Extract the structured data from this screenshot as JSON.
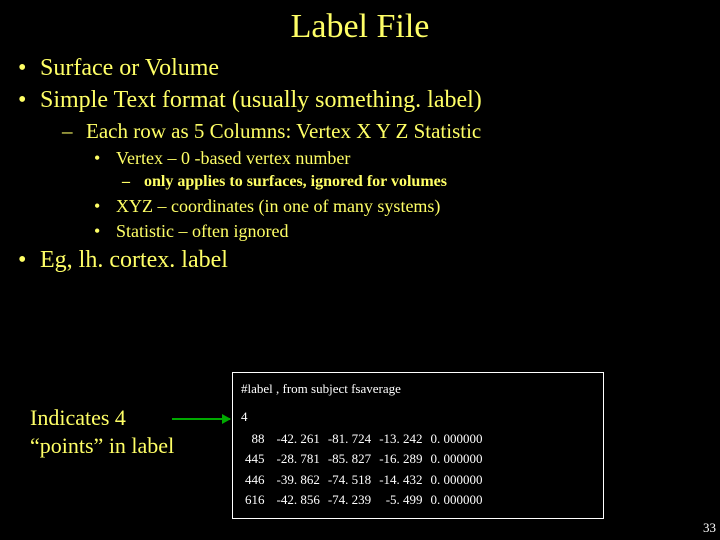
{
  "title": "Label File",
  "bullets": {
    "l1a": "Surface or Volume",
    "l1b": "Simple Text format (usually something. label)",
    "l2a": "Each row as 5 Columns: Vertex  X Y Z Statistic",
    "l3a": "Vertex – 0 -based vertex number",
    "l4a": "only applies to surfaces, ignored for volumes",
    "l3b": "XYZ – coordinates (in one of many systems)",
    "l3c": "Statistic – often ignored",
    "l1c": "Eg, lh. cortex. label"
  },
  "indicates": {
    "line1": "Indicates 4",
    "line2": "“points” in label"
  },
  "file": {
    "header": "#label , from subject fsaverage",
    "count": "4",
    "rows": [
      {
        "v": "88",
        "x": "-42. 261",
        "y": "-81. 724",
        "z": "-13. 242",
        "s": "0. 000000"
      },
      {
        "v": "445",
        "x": "-28. 781",
        "y": "-85. 827",
        "z": "-16. 289",
        "s": "0. 000000"
      },
      {
        "v": "446",
        "x": "-39. 862",
        "y": "-74. 518",
        "z": "-14. 432",
        "s": "0. 000000"
      },
      {
        "v": "616",
        "x": "-42. 856",
        "y": "-74. 239",
        "z": "-5. 499",
        "s": "0. 000000"
      }
    ]
  },
  "pagenum": "33"
}
